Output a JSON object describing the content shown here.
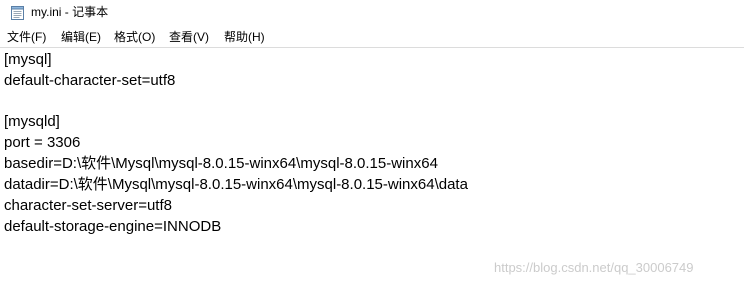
{
  "window": {
    "title": "my.ini - 记事本",
    "icon": "notepad-icon"
  },
  "menu": {
    "items": [
      {
        "label": "文件(F)"
      },
      {
        "label": "编辑(E)"
      },
      {
        "label": "格式(O)"
      },
      {
        "label": "查看(V)"
      },
      {
        "label": "帮助(H)"
      }
    ]
  },
  "editor": {
    "lines": [
      "[mysql]",
      "default-character-set=utf8",
      "",
      "[mysqld]",
      "port = 3306",
      "basedir=D:\\软件\\Mysql\\mysql-8.0.15-winx64\\mysql-8.0.15-winx64",
      "datadir=D:\\软件\\Mysql\\mysql-8.0.15-winx64\\mysql-8.0.15-winx64\\data",
      "character-set-server=utf8",
      "default-storage-engine=INNODB"
    ]
  },
  "watermark": {
    "text": "https://blog.csdn.net/qq_30006749"
  }
}
